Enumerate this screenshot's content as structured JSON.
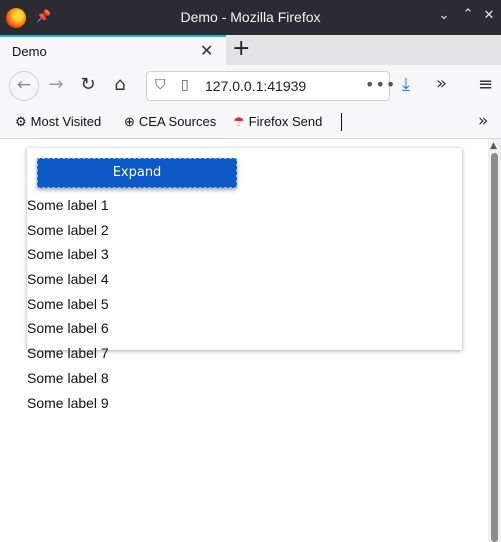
{
  "window": {
    "title": "Demo - Mozilla Firefox",
    "min_icon": "chevron-down-icon",
    "max_icon": "chevron-up-icon",
    "close_icon": "close-icon"
  },
  "tabs": [
    {
      "label": "Demo",
      "active": true
    }
  ],
  "nav": {
    "url": "127.0.0.1:41939"
  },
  "bookmarks": {
    "items": [
      {
        "label": "Most Visited",
        "icon": "gear-icon"
      },
      {
        "label": "CEA Sources",
        "icon": "globe-icon"
      },
      {
        "label": "Firefox Send",
        "icon": "firefox-send-icon"
      }
    ]
  },
  "page": {
    "expand_label": "Expand",
    "labels": [
      "Some label 1",
      "Some label 2",
      "Some label 3",
      "Some label 4",
      "Some label 5",
      "Some label 6",
      "Some label 7",
      "Some label 8",
      "Some label 9"
    ]
  },
  "colors": {
    "button_bg": "#0b59c6",
    "tab_accent": "#1fb6c9",
    "download_accent": "#0a84ff"
  }
}
